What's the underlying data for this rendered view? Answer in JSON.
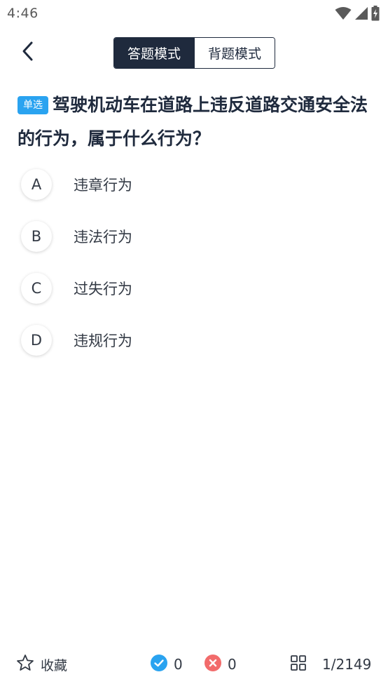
{
  "status_bar": {
    "time": "4:46",
    "icons": [
      "wifi-icon",
      "signal-icon",
      "battery-charging-icon"
    ]
  },
  "header": {
    "back_icon": "chevron-left-icon",
    "tabs": [
      {
        "label": "答题模式",
        "active": true
      },
      {
        "label": "背题模式",
        "active": false
      }
    ]
  },
  "question": {
    "type_badge": "单选",
    "text": "驾驶机动车在道路上违反道路交通安全法的行为，属于什么行为？"
  },
  "options": [
    {
      "letter": "A",
      "text": "违章行为"
    },
    {
      "letter": "B",
      "text": "违法行为"
    },
    {
      "letter": "C",
      "text": "过失行为"
    },
    {
      "letter": "D",
      "text": "违规行为"
    }
  ],
  "bottom_bar": {
    "favorite_label": "收藏",
    "correct_count": "0",
    "wrong_count": "0",
    "progress": "1/2149"
  },
  "colors": {
    "primary": "#1f2a3d",
    "badge": "#2aa3f0",
    "correct": "#2aa3f0",
    "wrong": "#f26b6b"
  }
}
